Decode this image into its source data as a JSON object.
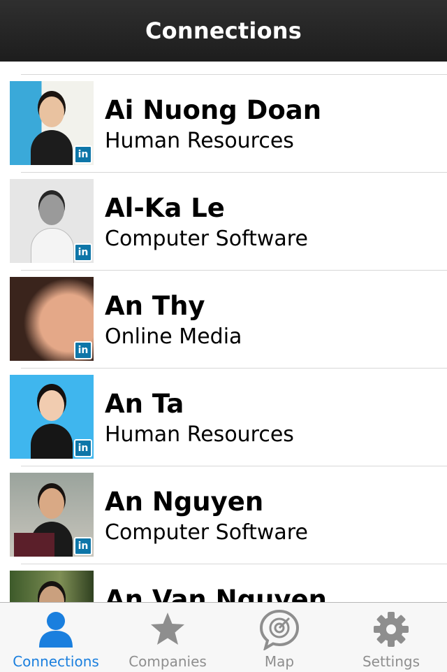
{
  "navbar": {
    "title": "Connections"
  },
  "connections": [
    {
      "name": "Ai Nuong Doan",
      "industry": "Human Resources",
      "badge": "in"
    },
    {
      "name": "Al-Ka Le",
      "industry": "Computer Software",
      "badge": "in"
    },
    {
      "name": "An Thy",
      "industry": "Online Media",
      "badge": "in"
    },
    {
      "name": "An Ta",
      "industry": "Human Resources",
      "badge": "in"
    },
    {
      "name": "An Nguyen",
      "industry": "Computer Software",
      "badge": "in"
    },
    {
      "name": "An Van Nguyen",
      "industry": "",
      "badge": ""
    }
  ],
  "tabbar": {
    "tabs": [
      {
        "label": "Connections",
        "icon": "person-icon",
        "active": true
      },
      {
        "label": "Companies",
        "icon": "star-icon",
        "active": false
      },
      {
        "label": "Map",
        "icon": "radar-icon",
        "active": false
      },
      {
        "label": "Settings",
        "icon": "gear-icon",
        "active": false
      }
    ]
  },
  "colors": {
    "accent": "#1a7fde",
    "navbar": "#222222",
    "linkedin": "#0e76a8"
  }
}
